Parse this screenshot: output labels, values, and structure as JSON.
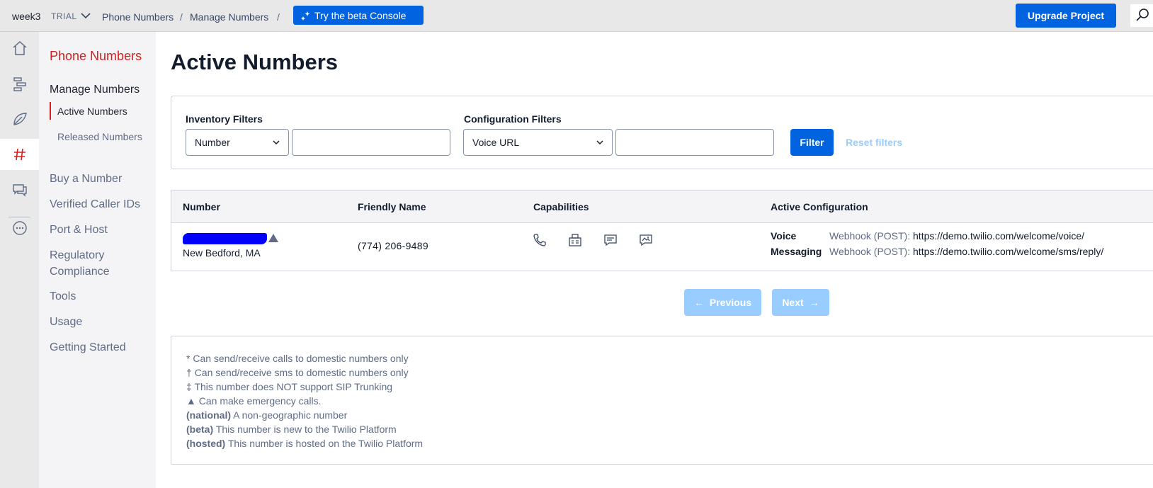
{
  "topbar": {
    "account": "week3",
    "trial": "TRIAL",
    "breadcrumb": [
      "Phone Numbers",
      "Manage Numbers"
    ],
    "beta_button": "Try the beta Console",
    "upgrade_button": "Upgrade Project"
  },
  "rail": {
    "icons": [
      "home-icon",
      "flows-icon",
      "studio-icon",
      "phone-numbers-icon",
      "messaging-icon",
      "more-icon"
    ],
    "active": "phone-numbers-icon"
  },
  "subnav": {
    "title": "Phone Numbers",
    "manage": "Manage Numbers",
    "active_numbers": "Active Numbers",
    "released_numbers": "Released Numbers",
    "items": [
      "Buy a Number",
      "Verified Caller IDs",
      "Port & Host",
      "Regulatory Compliance",
      "Tools",
      "Usage",
      "Getting Started"
    ]
  },
  "main": {
    "title": "Active Numbers",
    "filters": {
      "inventory_label": "Inventory Filters",
      "inventory_select": "Number",
      "config_label": "Configuration Filters",
      "config_select": "Voice URL",
      "filter_button": "Filter",
      "reset_link": "Reset filters"
    },
    "table": {
      "headers": [
        "Number",
        "Friendly Name",
        "Capabilities",
        "Active Configuration"
      ],
      "rows": [
        {
          "location": "New Bedford, MA",
          "friendly_name": "(774) 206-9489",
          "capabilities": [
            "voice-icon",
            "fax-icon",
            "sms-icon",
            "mms-icon"
          ],
          "voice_label": "Voice",
          "voice_method": "Webhook (POST):",
          "voice_url": "https://demo.twilio.com/welcome/voice/",
          "messaging_label": "Messaging",
          "messaging_method": "Webhook (POST):",
          "messaging_url": "https://demo.twilio.com/welcome/sms/reply/"
        }
      ]
    },
    "pagination": {
      "previous": "Previous",
      "next": "Next"
    },
    "legend": [
      {
        "mark": "*",
        "text": "Can send/receive calls to domestic numbers only"
      },
      {
        "mark": "†",
        "text": "Can send/receive sms to domestic numbers only"
      },
      {
        "mark": "‡",
        "text": "This number does NOT support SIP Trunking"
      },
      {
        "mark": "▲",
        "text": "Can make emergency calls."
      },
      {
        "mark": "(national)",
        "text": "A non-geographic number"
      },
      {
        "mark": "(beta)",
        "text": "This number is new to the Twilio Platform"
      },
      {
        "mark": "(hosted)",
        "text": "This number is hosted on the Twilio Platform"
      }
    ]
  },
  "colors": {
    "brand_red": "#d61f1f",
    "primary_blue": "#0263e0",
    "disabled_blue": "#99cdff",
    "redaction": "#0000ff"
  }
}
